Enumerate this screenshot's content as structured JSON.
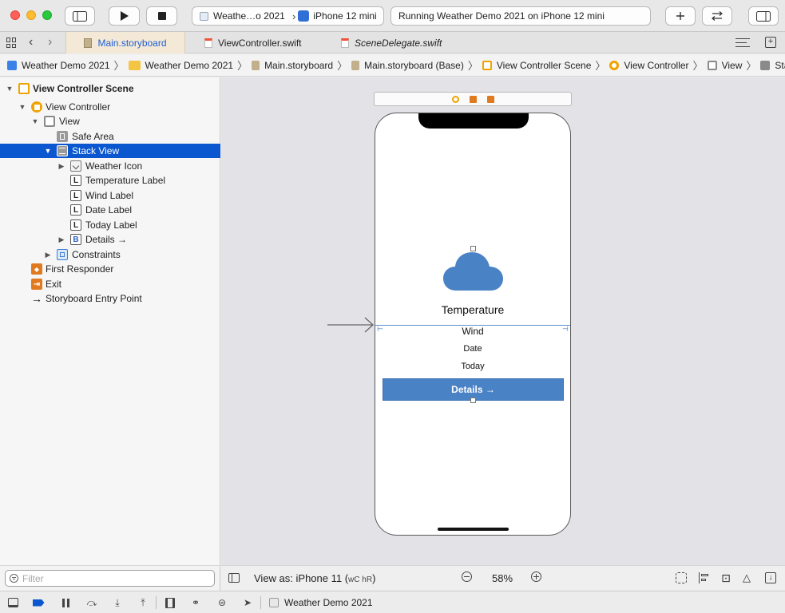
{
  "toolbar": {
    "scheme_name": "Weathe…o 2021",
    "device_name": "iPhone 12 mini",
    "activity_text": "Running Weather Demo 2021 on iPhone 12 mini"
  },
  "tabs": [
    {
      "label": "Main.storyboard"
    },
    {
      "label": "ViewController.swift"
    },
    {
      "label": "SceneDelegate.swift"
    }
  ],
  "jumpbar": [
    {
      "label": "Weather Demo 2021"
    },
    {
      "label": "Weather Demo 2021"
    },
    {
      "label": "Main.storyboard"
    },
    {
      "label": "Main.storyboard (Base)"
    },
    {
      "label": "View Controller Scene"
    },
    {
      "label": "View Controller"
    },
    {
      "label": "View"
    },
    {
      "label": "Stack View"
    }
  ],
  "outline": {
    "scene": "View Controller Scene",
    "view_controller": "View Controller",
    "view": "View",
    "safe_area": "Safe Area",
    "stack_view": "Stack View",
    "weather_icon": "Weather Icon",
    "temperature_label": "Temperature Label",
    "wind_label": "Wind Label",
    "date_label": "Date Label",
    "today_label": "Today Label",
    "details": "Details →",
    "constraints": "Constraints",
    "first_responder": "First Responder",
    "exit": "Exit",
    "entry_point": "Storyboard Entry Point",
    "label_glyph": "L",
    "button_glyph": "B"
  },
  "filter": {
    "placeholder": "Filter"
  },
  "phone": {
    "temperature": "Temperature",
    "wind": "Wind",
    "date": "Date",
    "today": "Today",
    "details_button": "Details →"
  },
  "canvas_bottom": {
    "view_as": "View as: iPhone 11 (",
    "size_class": "wC hR",
    "view_as_close": ")",
    "zoom": "58%"
  },
  "debug": {
    "target": "Weather Demo 2021"
  },
  "colors": {
    "selection": "#0a57d0",
    "accent_blue": "#4a82c6",
    "storyboard_orange": "#f0a300",
    "responder_orange": "#e07a1f"
  }
}
